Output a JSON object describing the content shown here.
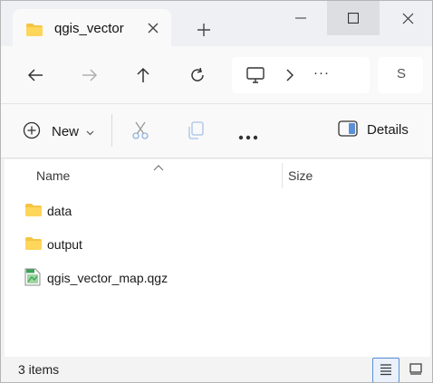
{
  "window": {
    "tab_title": "qgis_vector"
  },
  "address": {
    "overflow": "···",
    "search_glyph": "S"
  },
  "commandbar": {
    "new_label": "New",
    "details_label": "Details"
  },
  "columns": {
    "name": "Name",
    "size": "Size"
  },
  "files": [
    {
      "name": "data",
      "type": "folder"
    },
    {
      "name": "output",
      "type": "folder"
    },
    {
      "name": "qgis_vector_map.qgz",
      "type": "qgz"
    }
  ],
  "status": {
    "items": "3 items"
  },
  "colors": {
    "folder": "#f5c542",
    "accent": "#5b8fd6",
    "qgz_icon": "#3aa655"
  }
}
